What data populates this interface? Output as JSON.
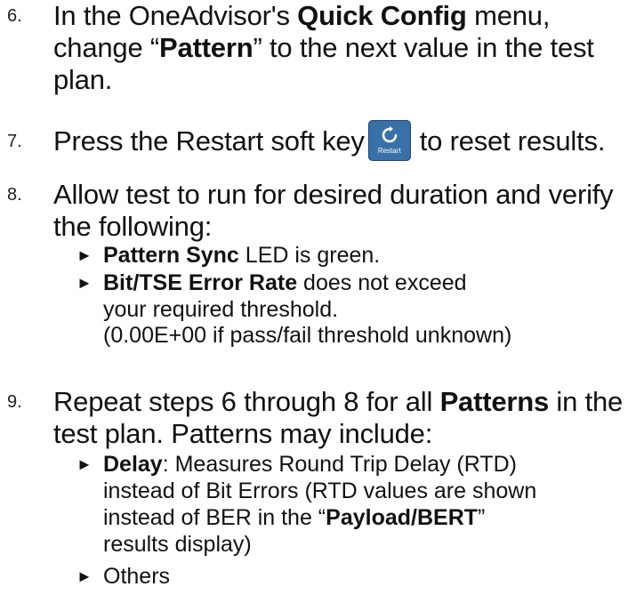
{
  "steps": [
    {
      "number": "6.",
      "lines": [
        [
          "In the OneAdvisor's ",
          "Quick Config",
          " menu,"
        ],
        [
          "change “",
          "Pattern",
          "” to the next value in the test"
        ],
        [
          "plan."
        ]
      ]
    },
    {
      "number": "7.",
      "before": "Press the Restart soft key",
      "after": "to reset results.",
      "softkey_label": "Restart",
      "softkey_icon": "restart-icon",
      "softkey_color": "#3a70a8"
    },
    {
      "number": "8.",
      "lines": [
        "Allow test to run for desired duration and verify",
        "the following:"
      ],
      "bullets": [
        {
          "bold": "Pattern Sync",
          "text": " LED is green."
        },
        {
          "bold": "Bit/TSE Error Rate",
          "text": " does not exceed",
          "cont": [
            "your required threshold.",
            "(0.00E+00 if pass/fail threshold unknown)"
          ]
        }
      ]
    },
    {
      "number": "9.",
      "line1": [
        "Repeat steps 6 through 8 for all ",
        "Patterns",
        " in the"
      ],
      "line2": "test plan.  Patterns may include:",
      "bullets": [
        {
          "bold": "Delay",
          "text": ": Measures Round Trip Delay (RTD)",
          "cont1": "instead of Bit Errors (RTD values are shown",
          "cont2": [
            "instead of BER in the “",
            "Payload/BERT",
            "”"
          ],
          "cont3": "results display)"
        },
        {
          "text": "Others"
        }
      ]
    }
  ],
  "bullet_glyph": "►"
}
